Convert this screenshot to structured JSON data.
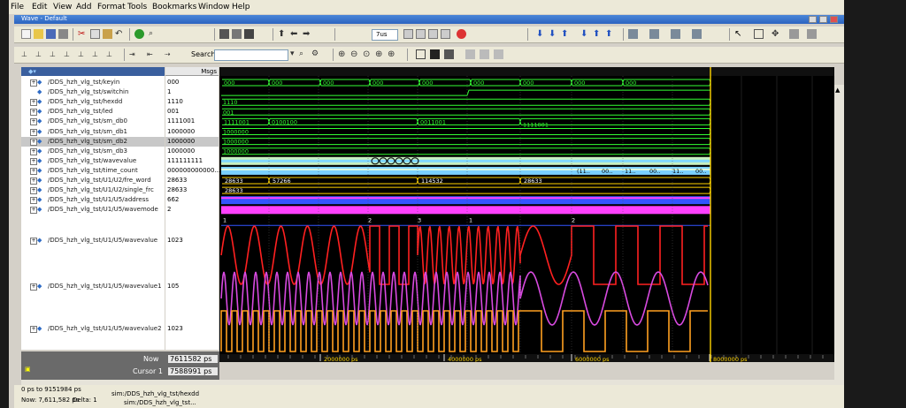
{
  "menu": [
    "File",
    "Edit",
    "View",
    "Add",
    "Format",
    "Tools",
    "Bookmarks",
    "Window",
    "Help"
  ],
  "window_title": "Wave - Default",
  "toolbar": {
    "time_step_value": "7us",
    "search_label": "Search:",
    "search_value": ""
  },
  "header": {
    "msgs_label": "Msgs"
  },
  "signals": [
    {
      "name": "/DDS_hzh_vlg_tst/keyin",
      "value": "000",
      "expandable": true
    },
    {
      "name": "/DDS_hzh_vlg_tst/switchin",
      "value": "1",
      "expandable": false
    },
    {
      "name": "/DDS_hzh_vlg_tst/hexdd",
      "value": "1110",
      "expandable": true
    },
    {
      "name": "/DDS_hzh_vlg_tst/led",
      "value": "001",
      "expandable": true
    },
    {
      "name": "/DDS_hzh_vlg_tst/sm_db0",
      "value": "1111001",
      "expandable": true
    },
    {
      "name": "/DDS_hzh_vlg_tst/sm_db1",
      "value": "1000000",
      "expandable": true
    },
    {
      "name": "/DDS_hzh_vlg_tst/sm_db2",
      "value": "1000000",
      "expandable": true,
      "selected": true
    },
    {
      "name": "/DDS_hzh_vlg_tst/sm_db3",
      "value": "1000000",
      "expandable": true
    },
    {
      "name": "/DDS_hzh_vlg_tst/wavevalue",
      "value": "111111111",
      "expandable": true
    },
    {
      "name": "/DDS_hzh_vlg_tst/time_count",
      "value": "000000000000...",
      "expandable": true
    },
    {
      "name": "/DDS_hzh_vlg_tst/U1/U2/fre_word",
      "value": "28633",
      "expandable": true
    },
    {
      "name": "/DDS_hzh_vlg_tst/U1/U2/single_frc",
      "value": "28633",
      "expandable": true
    },
    {
      "name": "/DDS_hzh_vlg_tst/U1/U5/address",
      "value": "662",
      "expandable": true
    },
    {
      "name": "/DDS_hzh_vlg_tst/U1/U5/wavemode",
      "value": "2",
      "expandable": true
    }
  ],
  "analog_signals": [
    {
      "name": "/DDS_hzh_vlg_tst/U1/U5/wavevalue",
      "value": "1023",
      "color": "#ff2020"
    },
    {
      "name": "/DDS_hzh_vlg_tst/U1/U5/wavevalue1",
      "value": "105",
      "color": "#d84ae0"
    },
    {
      "name": "/DDS_hzh_vlg_tst/U1/U5/wavevalue2",
      "value": "1023",
      "color": "#ffa020"
    }
  ],
  "bus_labels": {
    "keyin": [
      "000",
      "000",
      "000",
      "000",
      "000",
      "000",
      "000",
      "000",
      "000"
    ],
    "hexdd": "1110",
    "led": "001",
    "sm_db0": [
      "1111001",
      "0100100",
      "0011001",
      "1111001"
    ],
    "sm_db1": "1000000",
    "sm_db2": "1000000",
    "sm_db3": "1000000",
    "time_count_tail": [
      "(11..",
      "00..",
      "11..",
      "00..",
      "11..",
      "00.."
    ],
    "fre_word": [
      "28633",
      "57266",
      "114532",
      "28633"
    ],
    "single_frc": "28633",
    "wavemode_marks": [
      "1",
      "2",
      "3",
      "1",
      "2"
    ]
  },
  "cursor_info": {
    "now_label": "Now",
    "now_value": "7611582 ps",
    "cursor_label": "Cursor 1",
    "cursor_value": "7588991 ps",
    "cursor_flag": "7588991 ps"
  },
  "time_axis": {
    "labels": [
      "2000000 ps",
      "4000000 ps",
      "6000000 ps",
      "8000000 ps"
    ]
  },
  "status": {
    "range": "0 ps to 9151984 ps",
    "now": "Now: 7,611,582 ps",
    "delta": "Delta: 1",
    "sim1": "sim:/DDS_hzh_vlg_tst/hexdd",
    "sim2": "sim:/DDS_hzh_vlg_tst..."
  },
  "colors": {
    "wave_green": "#33ff33",
    "wave_blue": "#3355ff",
    "wave_magenta": "#ff40ff",
    "cursor_yellow": "#ffd400",
    "selected_bg": "#c8c8c8"
  }
}
